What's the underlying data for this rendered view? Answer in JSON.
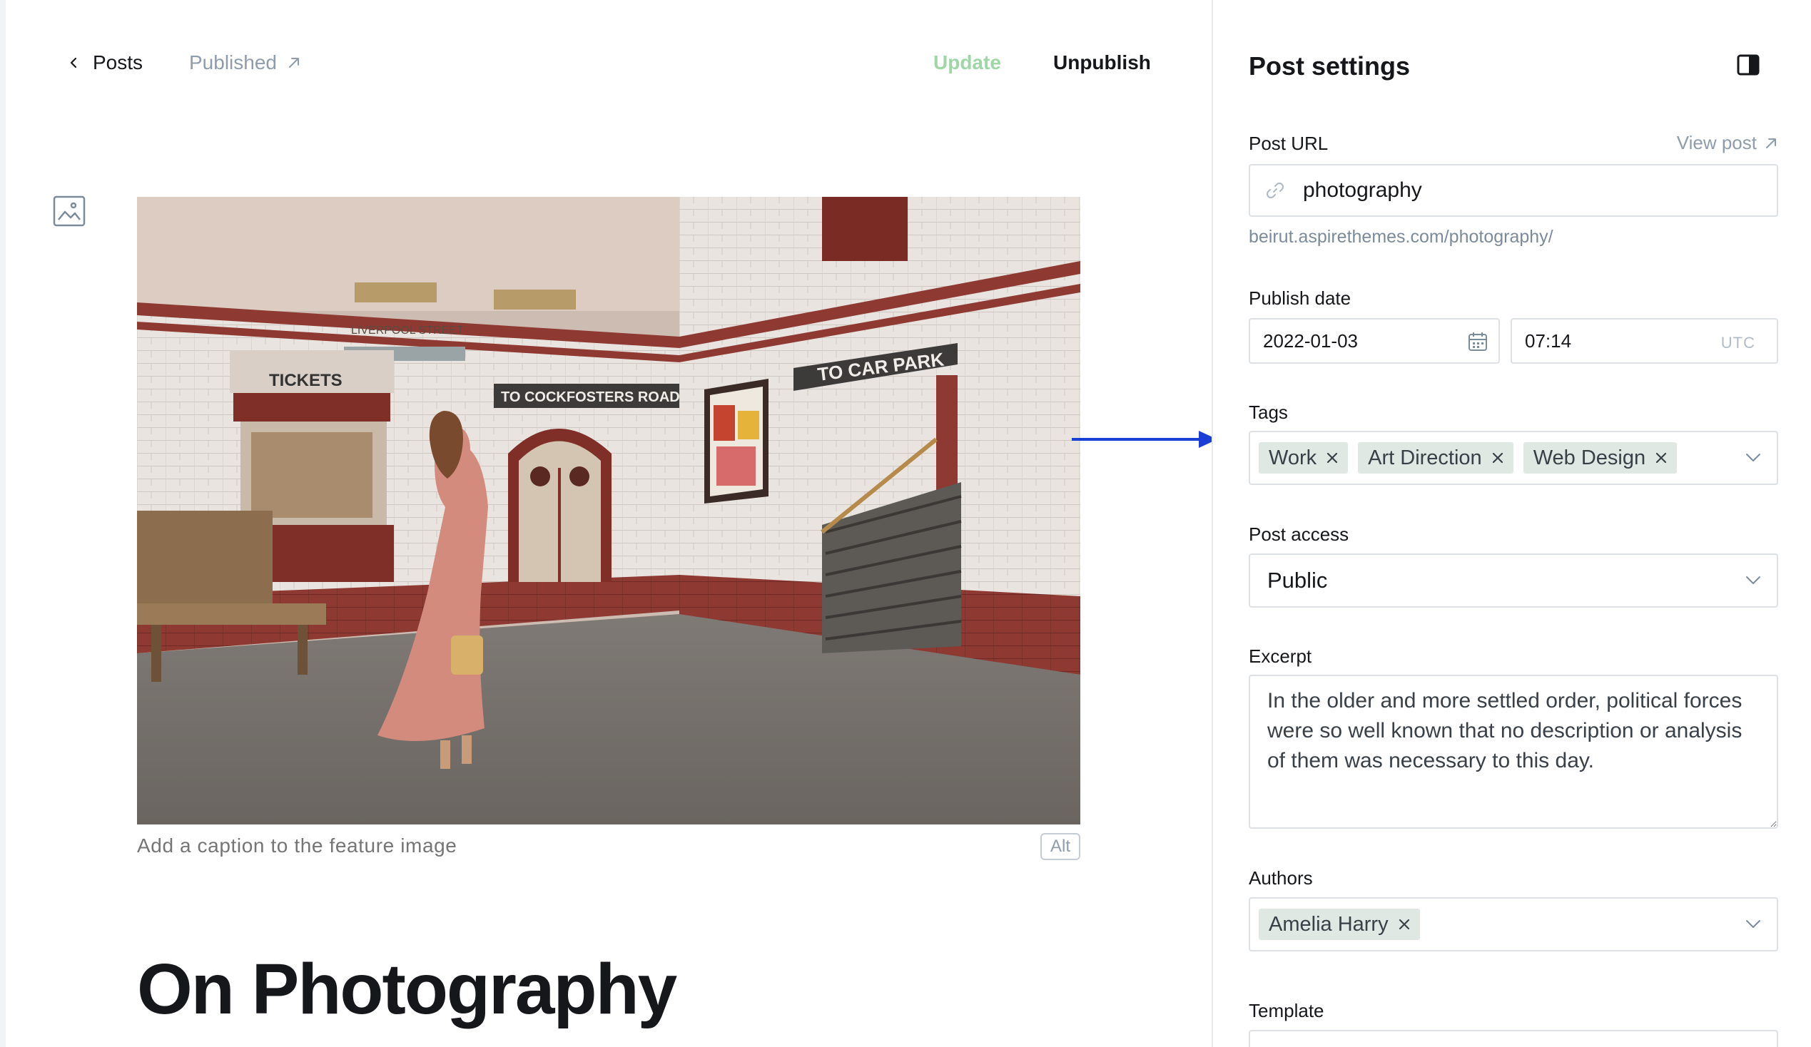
{
  "topbar": {
    "back_label": "Posts",
    "status_label": "Published",
    "update_label": "Update",
    "unpublish_label": "Unpublish"
  },
  "editor": {
    "caption_placeholder": "Add a caption to the feature image",
    "alt_label": "Alt",
    "post_title": "On Photography",
    "image_signs": {
      "tickets": "TICKETS",
      "liverpool": "LIVERPOOL STREET",
      "cockfosters": "TO COCKFOSTERS ROAD",
      "car_park": "TO CAR PARK"
    }
  },
  "settings": {
    "title": "Post settings",
    "post_url": {
      "label": "Post URL",
      "view_post_label": "View post",
      "value": "photography",
      "hint": "beirut.aspirethemes.com/photography/"
    },
    "publish_date": {
      "label": "Publish date",
      "date": "2022-01-03",
      "time": "07:14",
      "timezone": "UTC"
    },
    "tags": {
      "label": "Tags",
      "items": [
        "Work",
        "Art Direction",
        "Web Design"
      ]
    },
    "post_access": {
      "label": "Post access",
      "value": "Public"
    },
    "excerpt": {
      "label": "Excerpt",
      "value": "In the older and more settled order, political forces were so well known that no description or analysis of them was necessary to this day."
    },
    "authors": {
      "label": "Authors",
      "items": [
        "Amelia Harry"
      ]
    },
    "template": {
      "label": "Template"
    }
  },
  "colors": {
    "accent_green_light": "#9fd6a6",
    "tag_bg": "#dfe8e3",
    "muted_text": "#8e9cac",
    "annotation_arrow": "#1b3fd6"
  }
}
